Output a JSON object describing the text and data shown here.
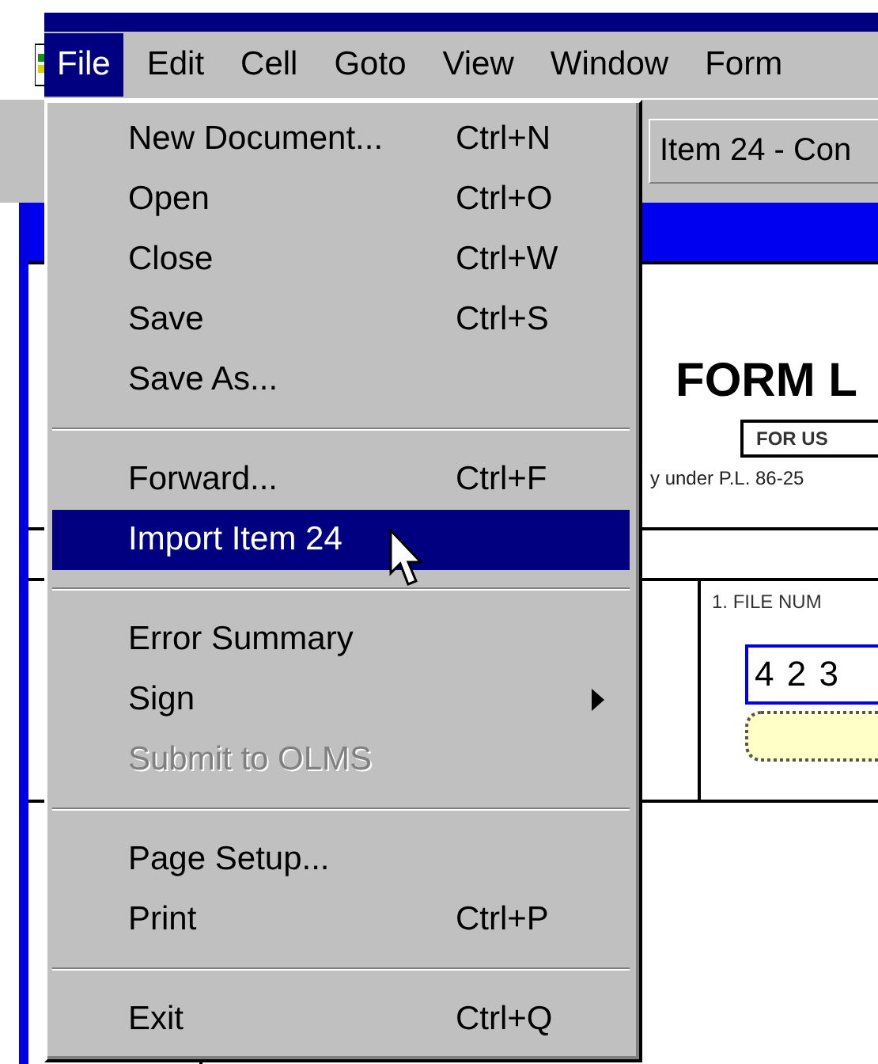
{
  "menubar": [
    {
      "label": "File",
      "selected": true
    },
    {
      "label": "Edit",
      "selected": false
    },
    {
      "label": "Cell",
      "selected": false
    },
    {
      "label": "Goto",
      "selected": false
    },
    {
      "label": "View",
      "selected": false
    },
    {
      "label": "Window",
      "selected": false
    },
    {
      "label": "Form",
      "selected": false
    }
  ],
  "child_window": {
    "title": "Item 24 - Con"
  },
  "document": {
    "title": "FORM L",
    "box_label": "FOR US",
    "subtitle": "y under P.L. 86-25",
    "field_label": "1. FILE NUM",
    "file_number": "4 2 3"
  },
  "file_menu": [
    {
      "kind": "item",
      "label": "New Document...",
      "shortcut": "Ctrl+N",
      "selected": false,
      "disabled": false
    },
    {
      "kind": "item",
      "label": "Open",
      "shortcut": "Ctrl+O",
      "selected": false,
      "disabled": false
    },
    {
      "kind": "item",
      "label": "Close",
      "shortcut": "Ctrl+W",
      "selected": false,
      "disabled": false
    },
    {
      "kind": "item",
      "label": "Save",
      "shortcut": "Ctrl+S",
      "selected": false,
      "disabled": false
    },
    {
      "kind": "item",
      "label": "Save As...",
      "selected": false,
      "disabled": false
    },
    {
      "kind": "separator"
    },
    {
      "kind": "item",
      "label": "Forward...",
      "shortcut": "Ctrl+F",
      "selected": false,
      "disabled": false
    },
    {
      "kind": "item",
      "label": "Import Item 24",
      "selected": true,
      "disabled": false
    },
    {
      "kind": "separator"
    },
    {
      "kind": "item",
      "label": "Error Summary",
      "selected": false,
      "disabled": false
    },
    {
      "kind": "submenu",
      "label": "Sign",
      "selected": false,
      "disabled": false
    },
    {
      "kind": "item",
      "label": "Submit to OLMS",
      "selected": false,
      "disabled": true
    },
    {
      "kind": "separator"
    },
    {
      "kind": "item",
      "label": "Page Setup...",
      "selected": false,
      "disabled": false
    },
    {
      "kind": "item",
      "label": "Print",
      "shortcut": "Ctrl+P",
      "selected": false,
      "disabled": false
    },
    {
      "kind": "separator"
    },
    {
      "kind": "item",
      "label": "Exit",
      "shortcut": "Ctrl+Q",
      "selected": false,
      "disabled": false
    }
  ]
}
